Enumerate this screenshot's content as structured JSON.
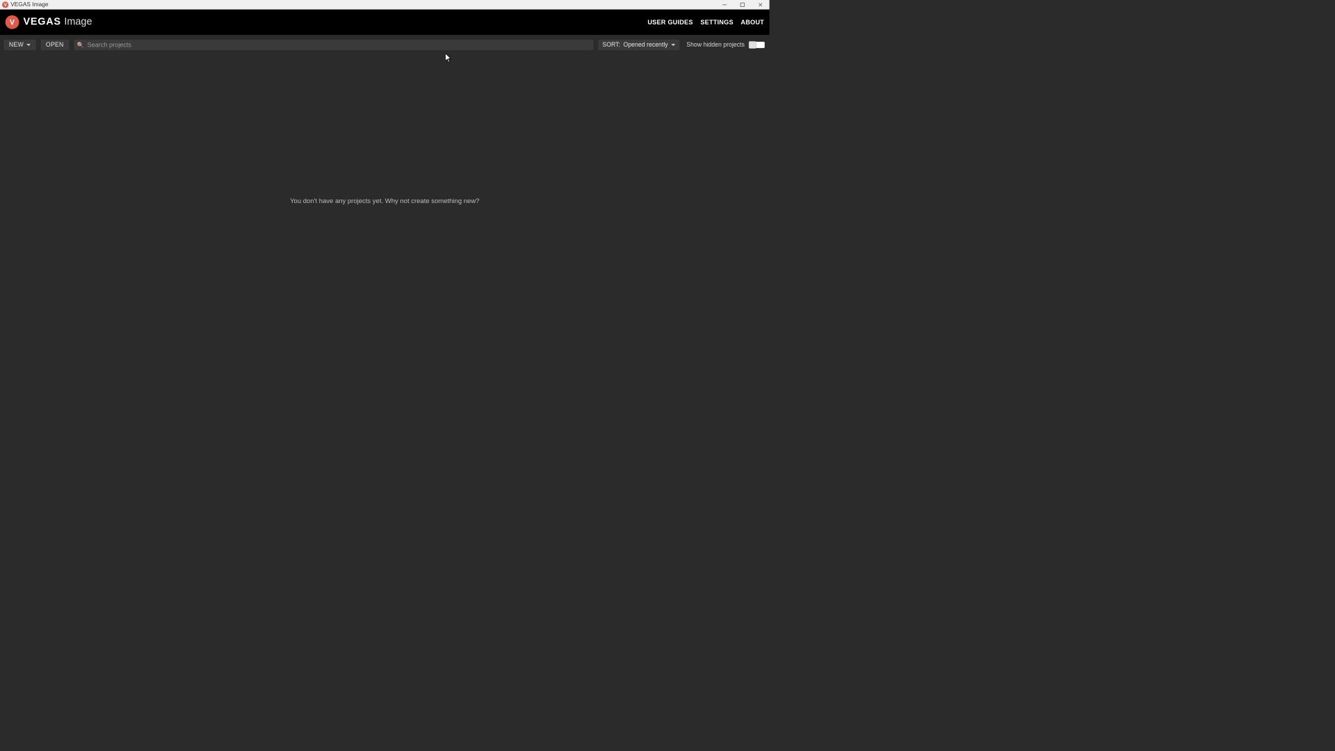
{
  "window": {
    "title": "VEGAS Image",
    "icon_letter": "V"
  },
  "header": {
    "brand_icon_letter": "V",
    "brand_main": "VEGAS",
    "brand_sub": "Image",
    "nav": {
      "user_guides": "USER GUIDES",
      "settings": "SETTINGS",
      "about": "ABOUT"
    }
  },
  "toolbar": {
    "new_label": "NEW",
    "open_label": "OPEN",
    "search_placeholder": "Search projects",
    "sort_prefix": "SORT:",
    "sort_value": "Opened recently",
    "show_hidden_label": "Show hidden projects",
    "show_hidden_on": false
  },
  "main": {
    "empty_message": "You don't have any projects yet. Why not create something new?"
  },
  "colors": {
    "accent": "#e05a4a",
    "bg": "#2b2b2b",
    "panel": "#3a3a3a",
    "header_bg": "#000000"
  }
}
